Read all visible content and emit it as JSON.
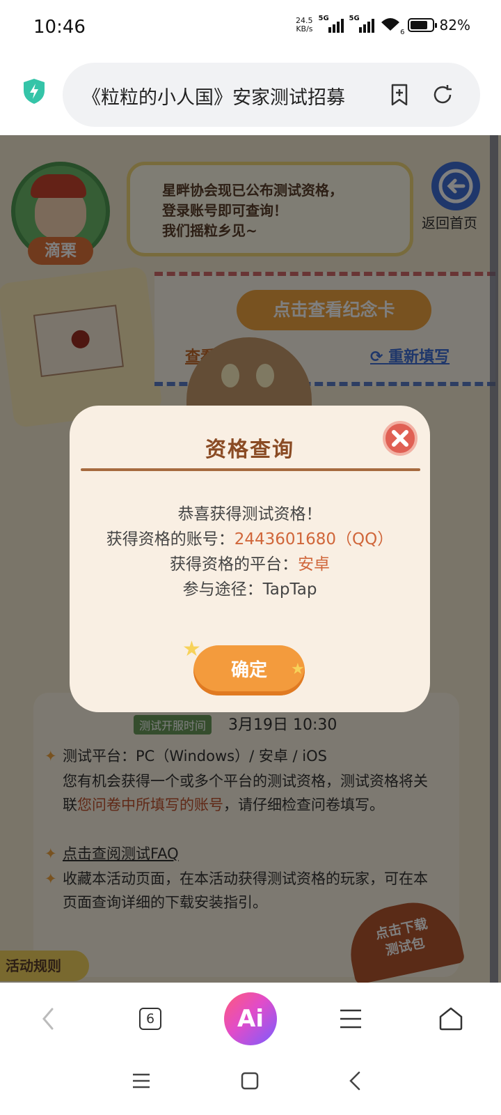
{
  "status_bar": {
    "time": "10:46",
    "net_speed_value": "24.5",
    "net_speed_unit": "KB/s",
    "signal1_label": "5G",
    "signal2_label": "5G",
    "wifi_badge": "6",
    "battery": "82%",
    "battery_level": 0.82
  },
  "browser": {
    "url_title": "《粒粒的小人国》安家测试招募",
    "tab_count": "6",
    "ai_label": "Ai"
  },
  "page": {
    "character_name": "滴栗",
    "speech_lines": [
      "星畔协会现已公布测试资格，",
      "登录账号即可查询！",
      "我们摇粒乡见~"
    ],
    "home_label": "返回首页",
    "card_button": "点击查看纪念卡",
    "link_view_record": "查看填写记录",
    "link_refill": "重新填写",
    "time_tag": "测试开服时间",
    "time_value": "3月19日  10:30",
    "platform_line": "测试平台：PC（Windows）/ 安卓 / iOS",
    "desc_pre": "您有机会获得一个或多个平台的测试资格，测试资格将关联",
    "desc_highlight": "您问卷中所填写的账号",
    "desc_post": "，请仔细检查问卷填写。",
    "faq_link": "点击查阅测试FAQ",
    "collect_line": "收藏本活动页面，在本活动获得测试资格的玩家，可在本页面查询详细的下载安装指引。",
    "rules_tag": "活动规则",
    "download_tag_line1": "点击下载",
    "download_tag_line2": "测试包"
  },
  "modal": {
    "title": "资格查询",
    "congrats": "恭喜获得测试资格！",
    "account_label": "获得资格的账号：",
    "account_value": "2443601680（QQ）",
    "platform_label": "获得资格的平台：",
    "platform_value": "安卓",
    "channel_label": "参与途径：",
    "channel_value": "TapTap",
    "ok_button": "确定"
  },
  "icons": {
    "shield": "shield-bolt-icon",
    "bookmark": "bookmark-add-icon",
    "refresh": "refresh-icon",
    "close": "close-icon",
    "back": "chevron-left-icon",
    "menu": "menu-icon",
    "home": "home-icon"
  },
  "colors": {
    "accent_orange": "#f39b3d",
    "value_orange": "#d0663a",
    "title_brown": "#8a4b24",
    "ai_gradient_start": "#ff5a7a",
    "ai_gradient_end": "#7a5cff"
  }
}
